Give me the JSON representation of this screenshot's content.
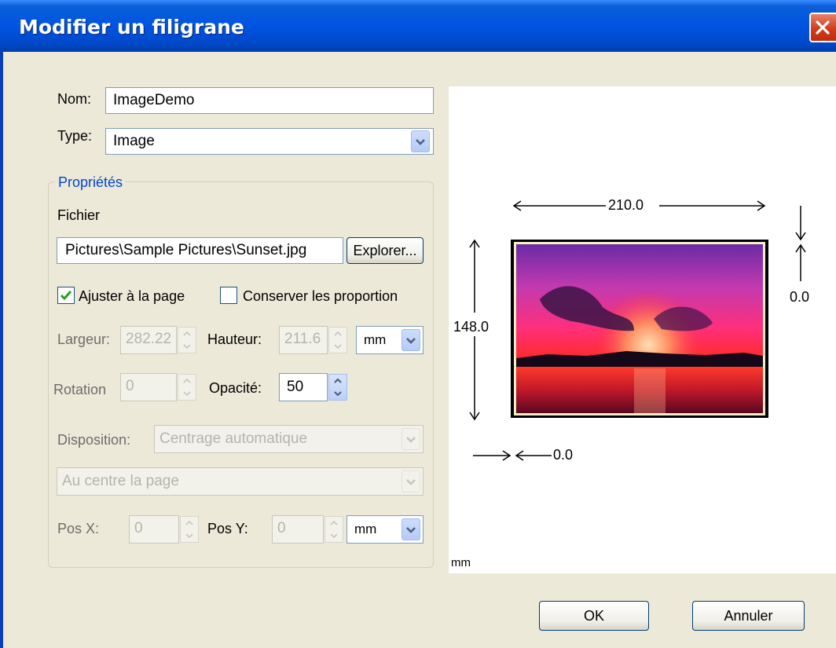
{
  "window": {
    "title": "Modifier un filigrane"
  },
  "form": {
    "nom_label": "Nom:",
    "nom_value": "ImageDemo",
    "type_label": "Type:",
    "type_value": "Image",
    "group_title": "Propriétés",
    "fichier_label": "Fichier",
    "fichier_value": "Pictures\\Sample Pictures\\Sunset.jpg",
    "explorer_label": "Explorer...",
    "ajuster_label": "Ajuster à la page",
    "ajuster_checked": true,
    "conserver_label": "Conserver les proportion",
    "conserver_checked": false,
    "largeur_label": "Largeur:",
    "largeur_value": "282.22",
    "hauteur_label": "Hauteur:",
    "hauteur_value": "211.6",
    "unit1_value": "mm",
    "rotation_label": "Rotation",
    "rotation_value": "0",
    "opacite_label": "Opacité:",
    "opacite_value": "50",
    "disposition_label": "Disposition:",
    "disposition_value": "Centrage automatique",
    "position_value": "Au centre la page",
    "posx_label": "Pos X:",
    "posx_value": "0",
    "posy_label": "Pos Y:",
    "posy_value": "0",
    "unit2_value": "mm"
  },
  "preview": {
    "width_label": "210.0",
    "height_label": "148.0",
    "top_offset_label": "0.0",
    "left_offset_label": "0.0",
    "unit_label": "mm"
  },
  "buttons": {
    "ok": "OK",
    "cancel": "Annuler"
  },
  "colors": {
    "titlebar": "#0054e3",
    "group_title": "#0046d5",
    "close": "#d03c1c"
  },
  "icons": [
    "close-icon",
    "chevron-down-icon",
    "spin-up-icon",
    "spin-down-icon",
    "checkmark-icon"
  ]
}
